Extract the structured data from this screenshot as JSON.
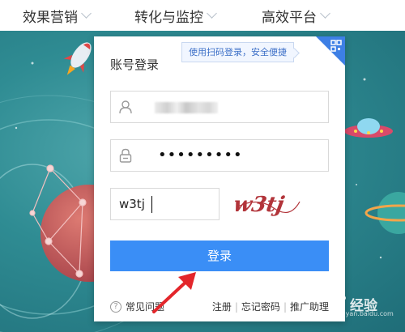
{
  "nav": {
    "items": [
      {
        "label": "效果营销"
      },
      {
        "label": "转化与监控"
      },
      {
        "label": "高效平台"
      }
    ]
  },
  "login": {
    "title": "账号登录",
    "qr_tip": "使用扫码登录，安全便捷",
    "password_mask": "•••••••••",
    "captcha_input": "w3tj",
    "captcha_image_text": "w3tj",
    "submit_label": "登录"
  },
  "footer": {
    "help_label": "常见问题",
    "links": [
      "注册",
      "忘记密码",
      "推广助理"
    ]
  },
  "watermark": {
    "text": "经验",
    "sub": "jingyan.baidu.com"
  },
  "colors": {
    "primary": "#3a8ef6",
    "qr_corner": "#3d7fe5",
    "background": "#2f8c93",
    "arrow": "#e3262b"
  }
}
